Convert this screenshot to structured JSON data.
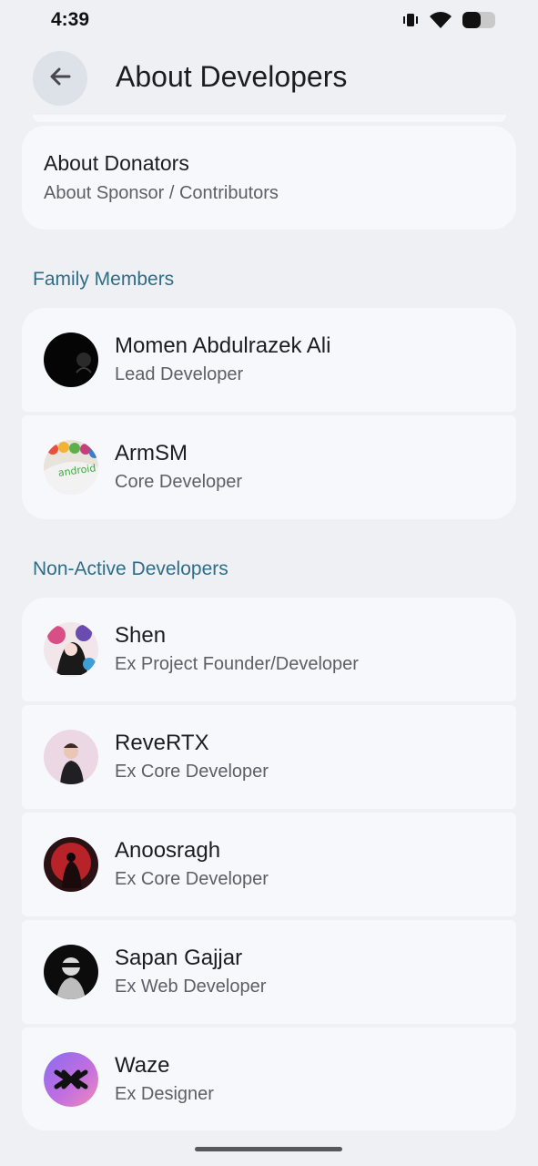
{
  "status_bar": {
    "time": "4:39",
    "icons": [
      "vibrate-icon",
      "wifi-icon",
      "battery-icon"
    ]
  },
  "top_bar": {
    "back_icon": "arrow-back-icon",
    "title": "About Developers"
  },
  "donators_card": {
    "title": "About Donators",
    "subtitle": "About Sponsor / Contributors"
  },
  "sections": [
    {
      "header": "Family Members",
      "members": [
        {
          "name": "Momen Abdulrazek Ali",
          "role": "Lead Developer"
        },
        {
          "name": "ArmSM",
          "role": "Core Developer"
        }
      ]
    },
    {
      "header": "Non-Active Developers",
      "members": [
        {
          "name": "Shen",
          "role": "Ex Project Founder/Developer"
        },
        {
          "name": "ReveRTX",
          "role": "Ex Core Developer"
        },
        {
          "name": "Anoosragh",
          "role": "Ex Core Developer"
        },
        {
          "name": "Sapan Gajjar",
          "role": "Ex Web Developer"
        },
        {
          "name": "Waze",
          "role": "Ex Designer"
        }
      ]
    }
  ],
  "colors": {
    "background": "#eef0f4",
    "card": "#f7f8fc",
    "section_header": "#2f6d86",
    "back_button_bg": "#dde2e9"
  }
}
